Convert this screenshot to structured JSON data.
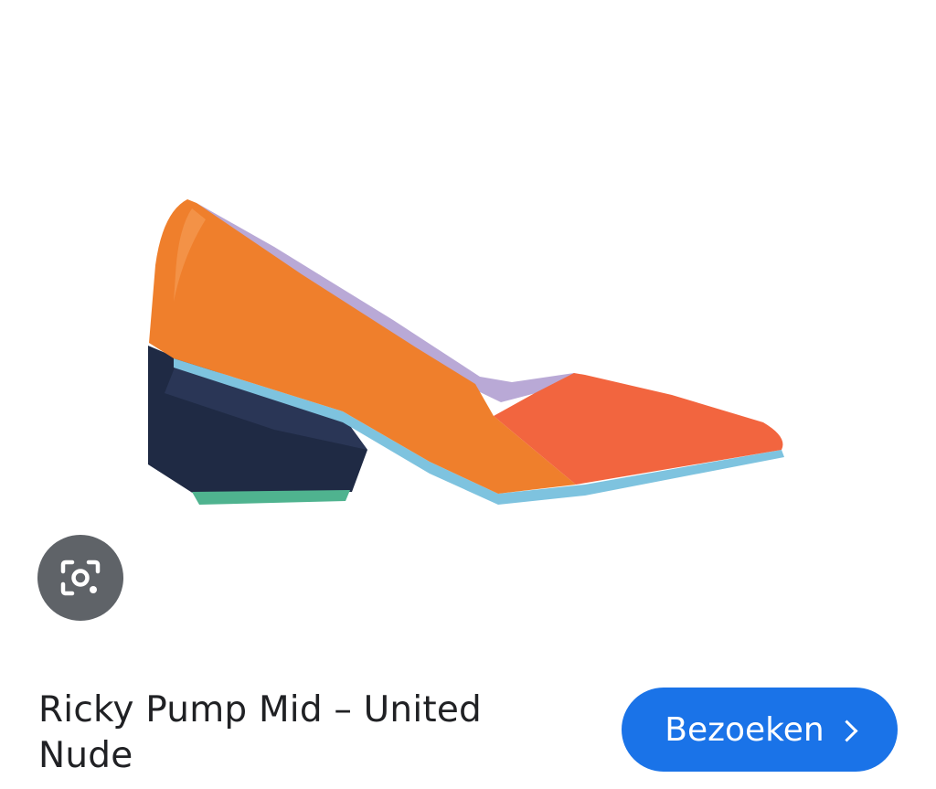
{
  "product": {
    "title": "Ricky Pump Mid – United Nude",
    "image_subject": "shoe-image"
  },
  "actions": {
    "visit_label": "Bezoeken",
    "lens_icon": "google-lens-icon",
    "chevron_icon": "chevron-right-icon"
  },
  "colors": {
    "accent": "#1a73e8",
    "lens_bg": "#5f6368",
    "shoe_orange": "#ef7f2c",
    "shoe_coral": "#f2653f",
    "heel_navy": "#1f2a44",
    "sole_blue": "#7ec3df",
    "heel_tip_green": "#4fb38f",
    "lining_lavender": "#b9a9d6"
  }
}
